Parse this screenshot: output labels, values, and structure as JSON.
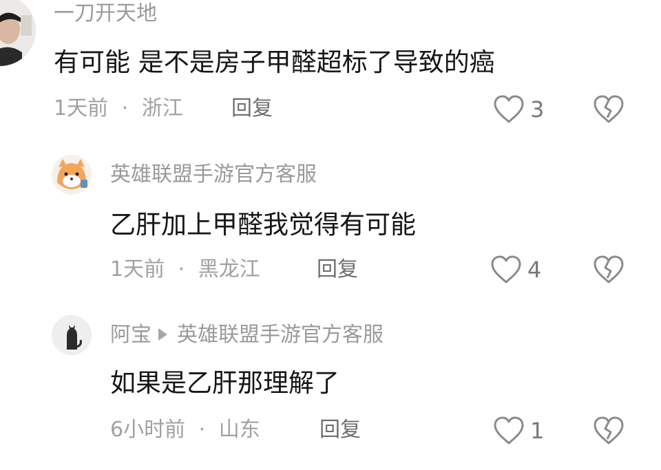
{
  "comments": [
    {
      "author": "一刀开天地",
      "text": "有可能 是不是房子甲醛超标了导致的癌",
      "time": "1天前",
      "location": "浙江",
      "reply_label": "回复",
      "likes": "3"
    },
    {
      "author": "英雄联盟手游官方客服",
      "text": "乙肝加上甲醛我觉得有可能",
      "time": "1天前",
      "location": "黑龙江",
      "reply_label": "回复",
      "likes": "4"
    },
    {
      "author": "阿宝",
      "reply_to": "英雄联盟手游官方客服",
      "text": "如果是乙肝那理解了",
      "time": "6小时前",
      "location": "山东",
      "reply_label": "回复",
      "likes": "1"
    }
  ],
  "separator": "·",
  "icons": {
    "like": "heart-outline-icon",
    "dislike": "broken-heart-icon",
    "reply_arrow": "triangle-right-icon"
  },
  "colors": {
    "text": "#161616",
    "muted": "#9a9a9a",
    "icon": "#888888"
  }
}
